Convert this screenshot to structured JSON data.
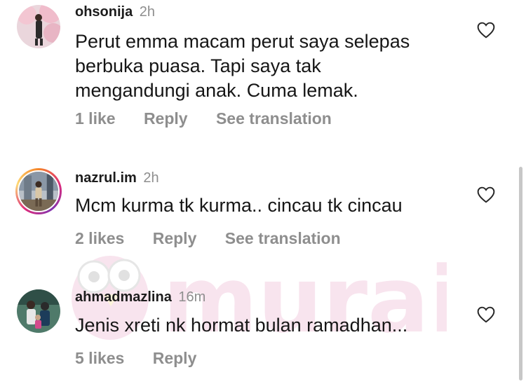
{
  "comments": [
    {
      "username": "ohsonija",
      "time": "2h",
      "lines": [
        "Perut emma macam perut saya selepas",
        "berbuka puasa. Tapi saya tak",
        "mengandungi anak. Cuma lemak."
      ],
      "likes": "1 like",
      "reply": "Reply",
      "translate": "See translation",
      "story_ring": false
    },
    {
      "username": "nazrul.im",
      "time": "2h",
      "lines": [
        "Mcm kurma tk kurma.. cincau tk cincau"
      ],
      "likes": "2 likes",
      "reply": "Reply",
      "translate": "See translation",
      "story_ring": true
    },
    {
      "username": "ahmadmazlina",
      "time": "16m",
      "lines": [
        "Jenis xreti nk hormat bulan ramadhan..."
      ],
      "likes": "5 likes",
      "reply": "Reply",
      "story_ring": false
    }
  ],
  "watermark": {
    "text": "murai"
  },
  "colors": {
    "secondary_text": "#8e8e8e",
    "primary_text": "#1c1c1c",
    "watermark": "#d44a8c"
  },
  "icons": {
    "like": "heart-outline-icon"
  }
}
